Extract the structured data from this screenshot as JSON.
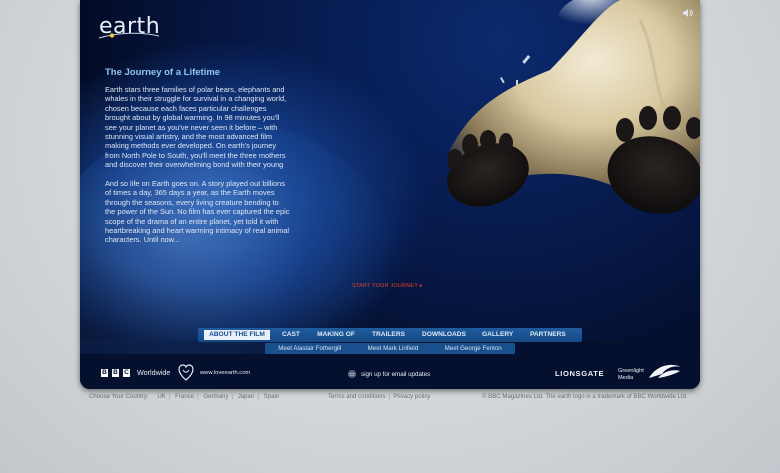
{
  "logo": {
    "text": "earth"
  },
  "content": {
    "title": "The Journey of a Lifetime",
    "paragraphs": [
      "Earth stars three families of polar bears, elephants and whales in their struggle for survival in a changing world, chosen because each faces particular challenges brought about by global warming. In 98 minutes you'll see your planet as you've never seen it before – with stunning visual artistry, and the most advanced film making methods ever developed. On earth's journey from North Pole to South, you'll meet the three mothers and discover their overwhelming bond with their young",
      "And so life on Earth goes on. A story played out billions of times a day, 365 days a year, as the Earth moves through the seasons, every living creature bending to the power of the Sun. No film has ever captured the epic scope of the drama of an entire planet, yet told it with heartbreaking and heart warming intimacy of real animal characters. Until now..."
    ]
  },
  "start_journey": "START YOUR JOURNEY ▸",
  "nav": [
    {
      "label": "ABOUT THE FILM",
      "active": true
    },
    {
      "label": "CAST",
      "active": false
    },
    {
      "label": "MAKING OF",
      "active": false
    },
    {
      "label": "TRAILERS",
      "active": false
    },
    {
      "label": "DOWNLOADS",
      "active": false
    },
    {
      "label": "GALLERY",
      "active": false
    },
    {
      "label": "PARTNERS",
      "active": false
    }
  ],
  "subnav": [
    "Meet Alastair Fothergill",
    "Meet Mark Linfield",
    "Meet George Fenton"
  ],
  "footer": {
    "bbc_letters": [
      "B",
      "B",
      "C"
    ],
    "bbc_worldwide": "Worldwide",
    "love_earth": "www.loveearth.com",
    "email_signup": "sign up for email updates",
    "lionsgate": "LIONSGATE",
    "greenlight_line1": "Greenlight",
    "greenlight_line2": "Media"
  },
  "below": {
    "country_label": "Choose Your Country:",
    "countries": [
      "UK",
      "France",
      "Germany",
      "Japan",
      "Spain"
    ],
    "terms": "Terms and conditions",
    "privacy": "Privacy policy",
    "copyright": "© BBC Magazines Ltd. The earth logo is a trademark of BBC Worldwide Ltd"
  },
  "colors": {
    "accent_blue": "#8fc7f0",
    "nav_bg": "#1f5c9e",
    "start_red": "#e2402c"
  },
  "icons": [
    "sound-icon",
    "polar-bear-image",
    "email-icon",
    "loveearth-icon",
    "greenlight-icon",
    "earth-swoosh-icon"
  ]
}
